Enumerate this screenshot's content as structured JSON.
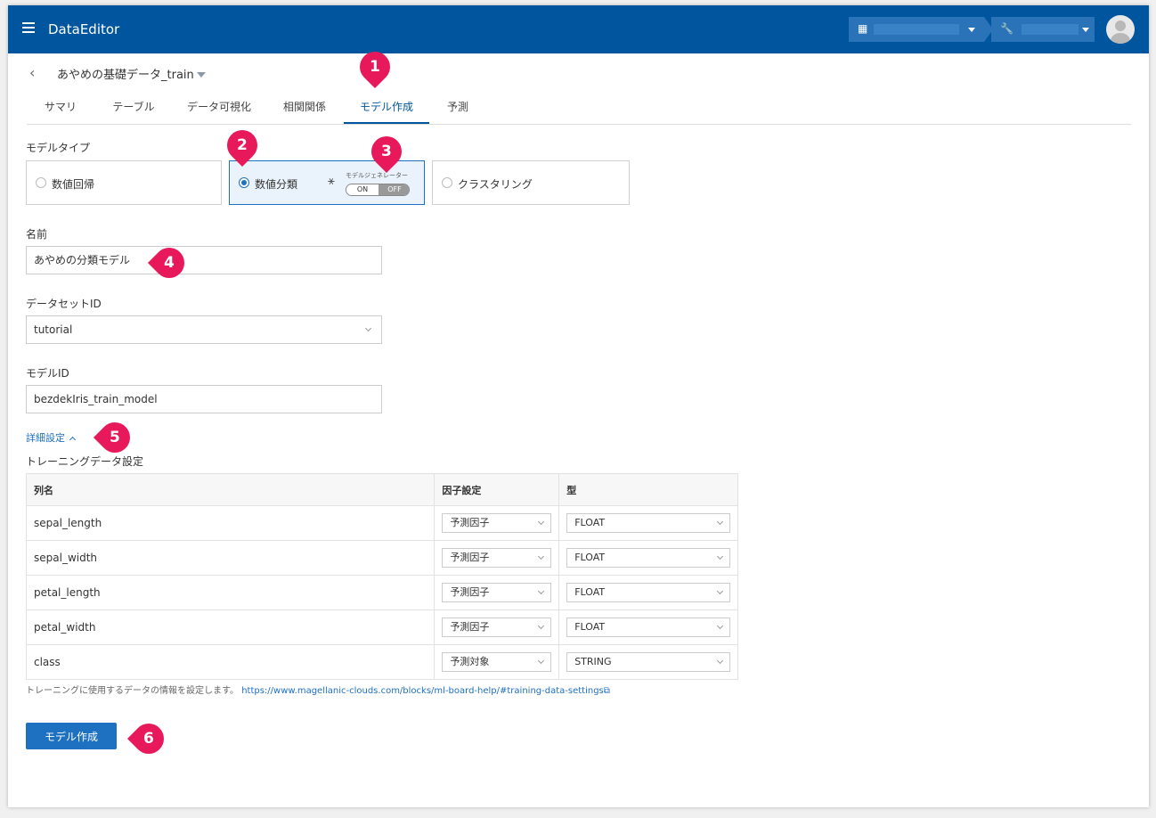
{
  "app": {
    "title": "DataEditor"
  },
  "header": {
    "org_icon": "building-icon",
    "tool_icon": "wrench-icon"
  },
  "page": {
    "title": "あやめの基礎データ_train"
  },
  "tabs": [
    {
      "label": "サマリ"
    },
    {
      "label": "テーブル"
    },
    {
      "label": "データ可視化"
    },
    {
      "label": "相関関係"
    },
    {
      "label": "モデル作成"
    },
    {
      "label": "予測"
    }
  ],
  "active_tab": "モデル作成",
  "model_type": {
    "label": "モデルタイプ",
    "options": [
      {
        "label": "数値回帰",
        "selected": false
      },
      {
        "label": "数値分類",
        "selected": true
      },
      {
        "label": "クラスタリング",
        "selected": false
      }
    ],
    "model_generator": {
      "label": "モデルジェネレーター",
      "on": "ON",
      "off": "OFF",
      "value": "OFF"
    }
  },
  "name": {
    "label": "名前",
    "value": "あやめの分類モデル"
  },
  "dataset_id": {
    "label": "データセットID",
    "value": "tutorial"
  },
  "model_id": {
    "label": "モデルID",
    "value": "bezdekIris_train_model"
  },
  "details": {
    "label": "詳細設定"
  },
  "training": {
    "label": "トレーニングデータ設定",
    "headers": [
      "列名",
      "因子設定",
      "型"
    ],
    "rows": [
      {
        "name": "sepal_length",
        "factor": "予測因子",
        "type": "FLOAT"
      },
      {
        "name": "sepal_width",
        "factor": "予測因子",
        "type": "FLOAT"
      },
      {
        "name": "petal_length",
        "factor": "予測因子",
        "type": "FLOAT"
      },
      {
        "name": "petal_width",
        "factor": "予測因子",
        "type": "FLOAT"
      },
      {
        "name": "class",
        "factor": "予測対象",
        "type": "STRING"
      }
    ],
    "note": "トレーニングに使用するデータの情報を設定します。",
    "help_link": "https://www.magellanic-clouds.com/blocks/ml-board-help/#training-data-settings"
  },
  "create_button": {
    "label": "モデル作成"
  },
  "markers": [
    "1",
    "2",
    "3",
    "4",
    "5",
    "6"
  ],
  "colors": {
    "header": "#00569e",
    "accent": "#1e70c0",
    "marker": "#e8195a"
  }
}
